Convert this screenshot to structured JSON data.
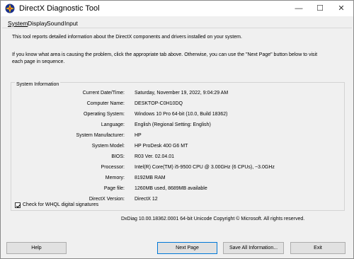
{
  "window": {
    "title": "DirectX Diagnostic Tool",
    "minimize_glyph": "—",
    "maximize_glyph": "☐",
    "close_glyph": "✕"
  },
  "tabs": [
    {
      "label": "System"
    },
    {
      "label": "Display"
    },
    {
      "label": "Sound"
    },
    {
      "label": "Input"
    }
  ],
  "intro": {
    "line1": "This tool reports detailed information about the DirectX components and drivers installed on your system.",
    "line2": "If you know what area is causing the problem, click the appropriate tab above.  Otherwise, you can use the \"Next Page\" button below to visit each page in sequence."
  },
  "system_info": {
    "group_title": "System Information",
    "rows": [
      {
        "label": "Current Date/Time:",
        "value": "Saturday, November 19, 2022, 9:04:29 AM"
      },
      {
        "label": "Computer Name:",
        "value": "DESKTOP-C0H10DQ"
      },
      {
        "label": "Operating System:",
        "value": "Windows 10 Pro 64-bit (10.0, Build 18362)"
      },
      {
        "label": "Language:",
        "value": "English (Regional Setting: English)"
      },
      {
        "label": "System Manufacturer:",
        "value": "HP"
      },
      {
        "label": "System Model:",
        "value": "HP ProDesk 400 G6 MT"
      },
      {
        "label": "BIOS:",
        "value": "R03 Ver. 02.04.01"
      },
      {
        "label": "Processor:",
        "value": "Intel(R) Core(TM) i5-9500 CPU @ 3.00GHz (6 CPUs), ~3.0GHz"
      },
      {
        "label": "Memory:",
        "value": "8192MB RAM"
      },
      {
        "label": "Page file:",
        "value": "1260MB used, 8689MB available"
      },
      {
        "label": "DirectX Version:",
        "value": "DirectX 12"
      }
    ]
  },
  "whql": {
    "label": "Check for WHQL digital signatures",
    "checked": true
  },
  "footer": {
    "text": "DxDiag 10.00.18362.0001 64-bit Unicode  Copyright © Microsoft. All rights reserved."
  },
  "buttons": {
    "help": "Help",
    "next_page": "Next Page",
    "save_all": "Save All Information...",
    "exit": "Exit"
  },
  "colors": {
    "accent_border": "#0078d7",
    "window_bg": "#f0f0f0"
  }
}
